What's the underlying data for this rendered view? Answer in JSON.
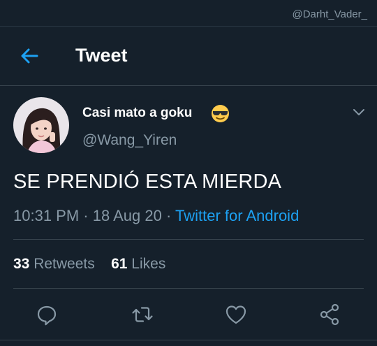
{
  "watermark": "@Darht_Vader_",
  "header": {
    "title": "Tweet",
    "back_icon": "arrow-left-icon"
  },
  "tweet": {
    "display_name": "Casi mato a goku",
    "name_emoji_icon": "sunglasses-emoji-icon",
    "handle": "@Wang_Yiren",
    "text": "SE PRENDIÓ ESTA MIERDA",
    "time": "10:31 PM",
    "separator1": " · ",
    "date": "18 Aug 20",
    "separator2": " · ",
    "source": "Twitter for Android"
  },
  "stats": {
    "retweets_count": "33",
    "retweets_label": "Retweets",
    "likes_count": "61",
    "likes_label": "Likes"
  },
  "actions": [
    "reply-icon",
    "retweet-icon",
    "like-icon",
    "share-icon"
  ],
  "colors": {
    "background": "#15202b",
    "accent": "#1da1f2",
    "secondary_text": "#8899a6",
    "divider": "#38444d"
  }
}
